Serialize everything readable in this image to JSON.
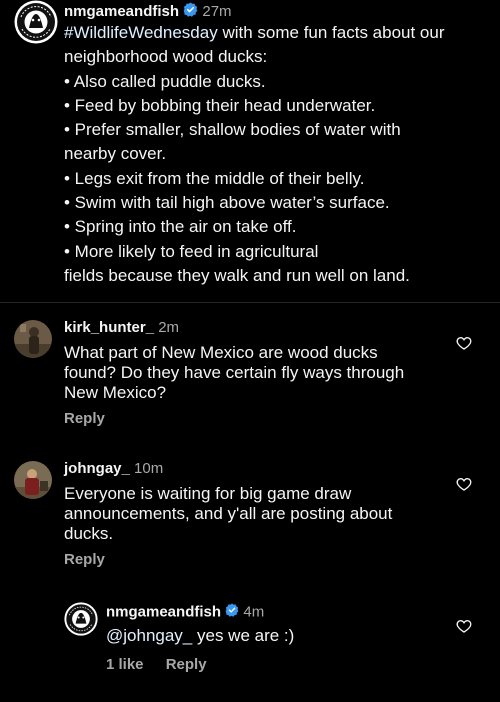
{
  "post": {
    "username": "nmgameandfish",
    "time": "27m",
    "hashtag": "#WildlifeWednesday",
    "lines": [
      " with some fun facts about our",
      "neighborhood wood ducks:",
      "• Also called puddle ducks.",
      "• Feed by bobbing their head underwater.",
      "• Prefer smaller, shallow bodies of water with",
      "nearby cover.",
      "• Legs exit from the middle of their belly.",
      "• Swim with tail high above water’s surface.",
      "• Spring into the air on take off.",
      "• More likely to feed in agricultural",
      "fields because they walk and run well on land."
    ],
    "logo_text": "NEW MEXICO GAME & FISH"
  },
  "comments": [
    {
      "username": "kirk_hunter_",
      "time": "2m",
      "lines": [
        "What part of New Mexico are wood ducks",
        "found? Do they have certain fly ways through",
        "New Mexico?"
      ],
      "reply_label": "Reply"
    },
    {
      "username": "johngay_",
      "time": "10m",
      "lines": [
        "Everyone is waiting for big game draw",
        "announcements, and y'all are posting about",
        "ducks."
      ],
      "reply_label": "Reply"
    }
  ],
  "reply": {
    "username": "nmgameandfish",
    "time": "4m",
    "mention": "@johngay_",
    "text": " yes we are :)",
    "likes_label": "1 like",
    "reply_label": "Reply"
  },
  "colors": {
    "background": "#000000",
    "verified": "#3897f0",
    "muted": "#a8a8a8"
  },
  "icons": [
    "verified-badge-icon",
    "heart-icon",
    "logo-icon"
  ]
}
